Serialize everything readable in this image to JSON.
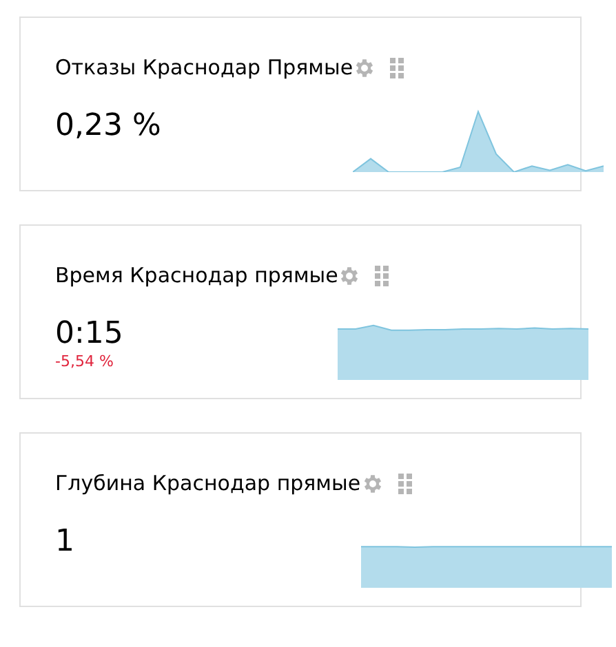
{
  "widgets": [
    {
      "title": "Отказы Краснодар Прямые",
      "value": "0,23 %"
    },
    {
      "title": "Время Краснодар прямые",
      "value": "0:15",
      "change": "-5,54 %"
    },
    {
      "title": "Глубина Краснодар прямые",
      "value": "1"
    }
  ]
}
